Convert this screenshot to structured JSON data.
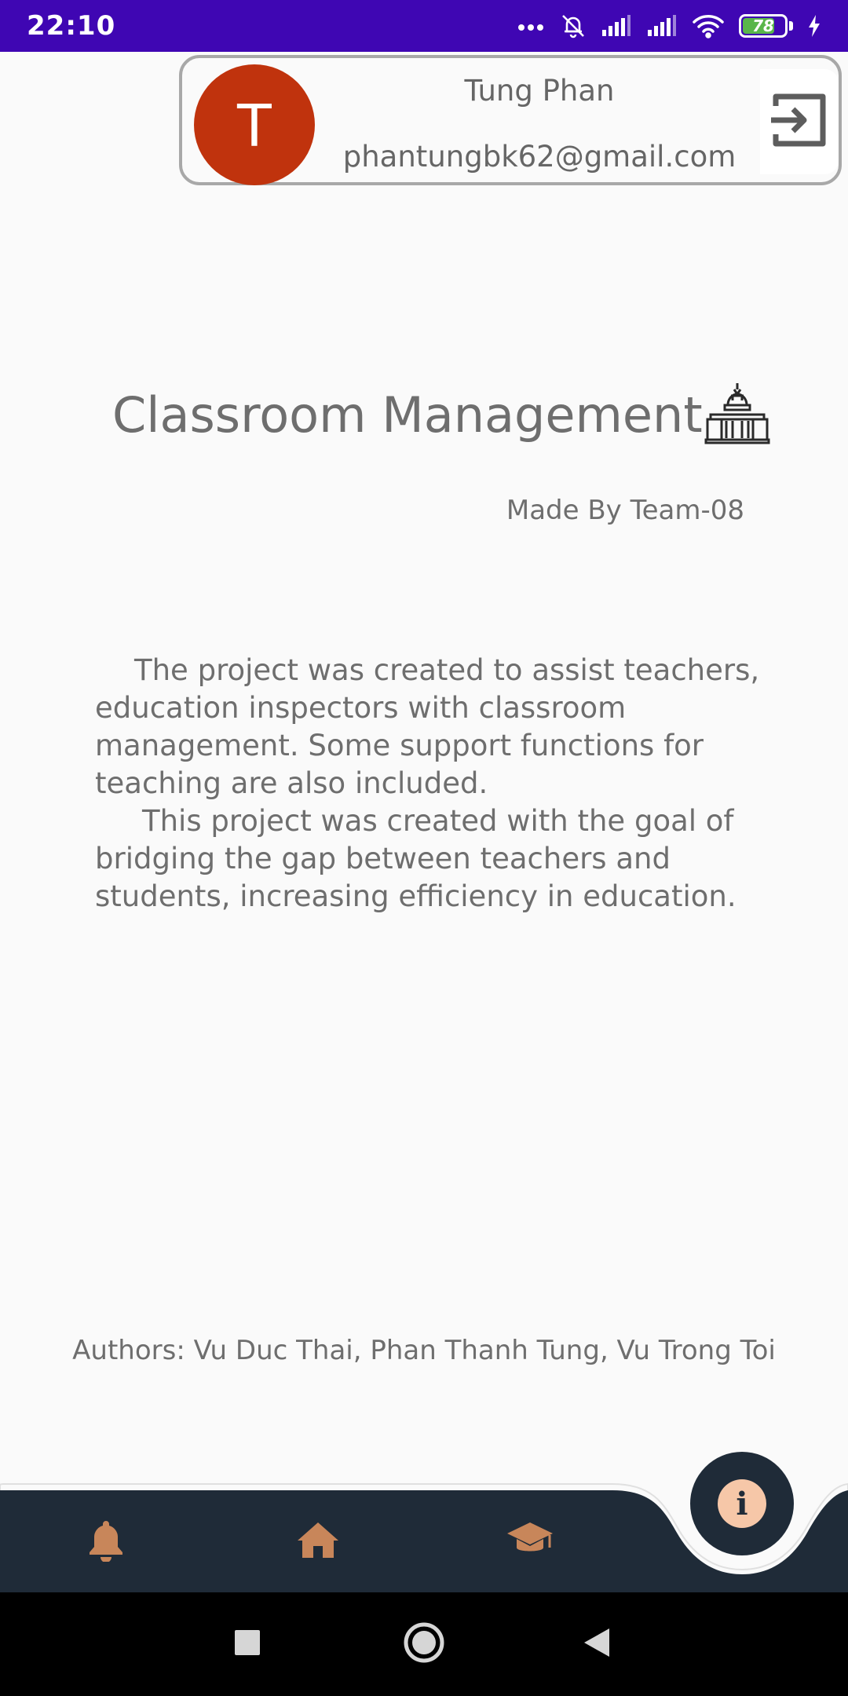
{
  "status_bar": {
    "time": "22:10",
    "battery_level": "78",
    "battery_fraction": 0.78,
    "icons": [
      "more-dots-icon",
      "bell-off-icon",
      "signal-icon",
      "signal-icon",
      "wifi-icon",
      "battery-icon",
      "charging-icon"
    ]
  },
  "user": {
    "avatar_letter": "T",
    "name": "Tung Phan",
    "email": "phantungbk62@gmail.com",
    "logout_icon": "logout-icon"
  },
  "main": {
    "title": "Classroom Management",
    "title_icon": "building-icon",
    "subtitle": "Made By Team-08",
    "description_paragraphs": [
      "The project was created to assist teachers, education inspectors with classroom management. Some support functions for teaching are also included.",
      "This project was created with the goal of bridging the gap between teachers and students, increasing efficiency in education."
    ],
    "authors": "Authors: Vu Duc Thai, Phan Thanh Tung, Vu Trong Toi"
  },
  "bottom_nav": {
    "items": [
      {
        "icon": "bell-icon"
      },
      {
        "icon": "home-icon"
      },
      {
        "icon": "graduation-cap-icon"
      }
    ],
    "fab_icon": "info-icon",
    "fab_label": "i",
    "colors": {
      "bar": "#1f2b38",
      "icon": "#c8865a",
      "fab_inner": "#f6c7a8"
    }
  },
  "system_nav": {
    "buttons": [
      "recents-icon",
      "home-circle-icon",
      "back-icon"
    ]
  },
  "colors": {
    "status_bar": "#3f06b3",
    "avatar": "#c0330d",
    "background": "#fafafa"
  }
}
